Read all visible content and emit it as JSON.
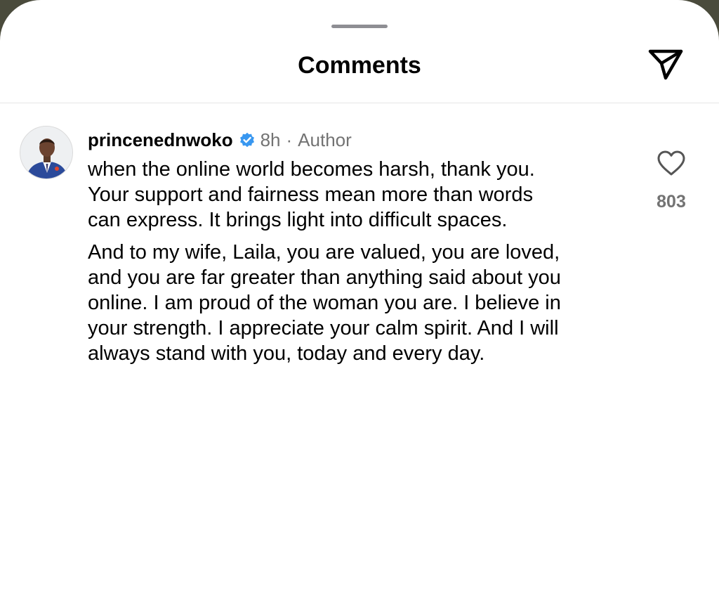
{
  "header": {
    "title": "Comments",
    "share_icon": "paper-plane-icon"
  },
  "comment": {
    "avatar_icon": "user-avatar-photo",
    "username": "princenednwoko",
    "verified_icon": "verified-badge-icon",
    "verified_color": "#3897f0",
    "time": "8h",
    "separator": "·",
    "role": "Author",
    "paragraphs": [
      "when the online world becomes harsh, thank you.\nYour support and fairness mean more than words\ncan express. It brings light into difficult spaces.",
      "And to my wife, Laila, you are valued, you are loved,\nand you are far greater than anything said about you\nonline. I am proud of the woman you are. I believe in\nyour strength. I appreciate your calm spirit. And I will\nalways stand with you, today and every day."
    ],
    "like_icon": "heart-outline-icon",
    "like_count": "803"
  }
}
